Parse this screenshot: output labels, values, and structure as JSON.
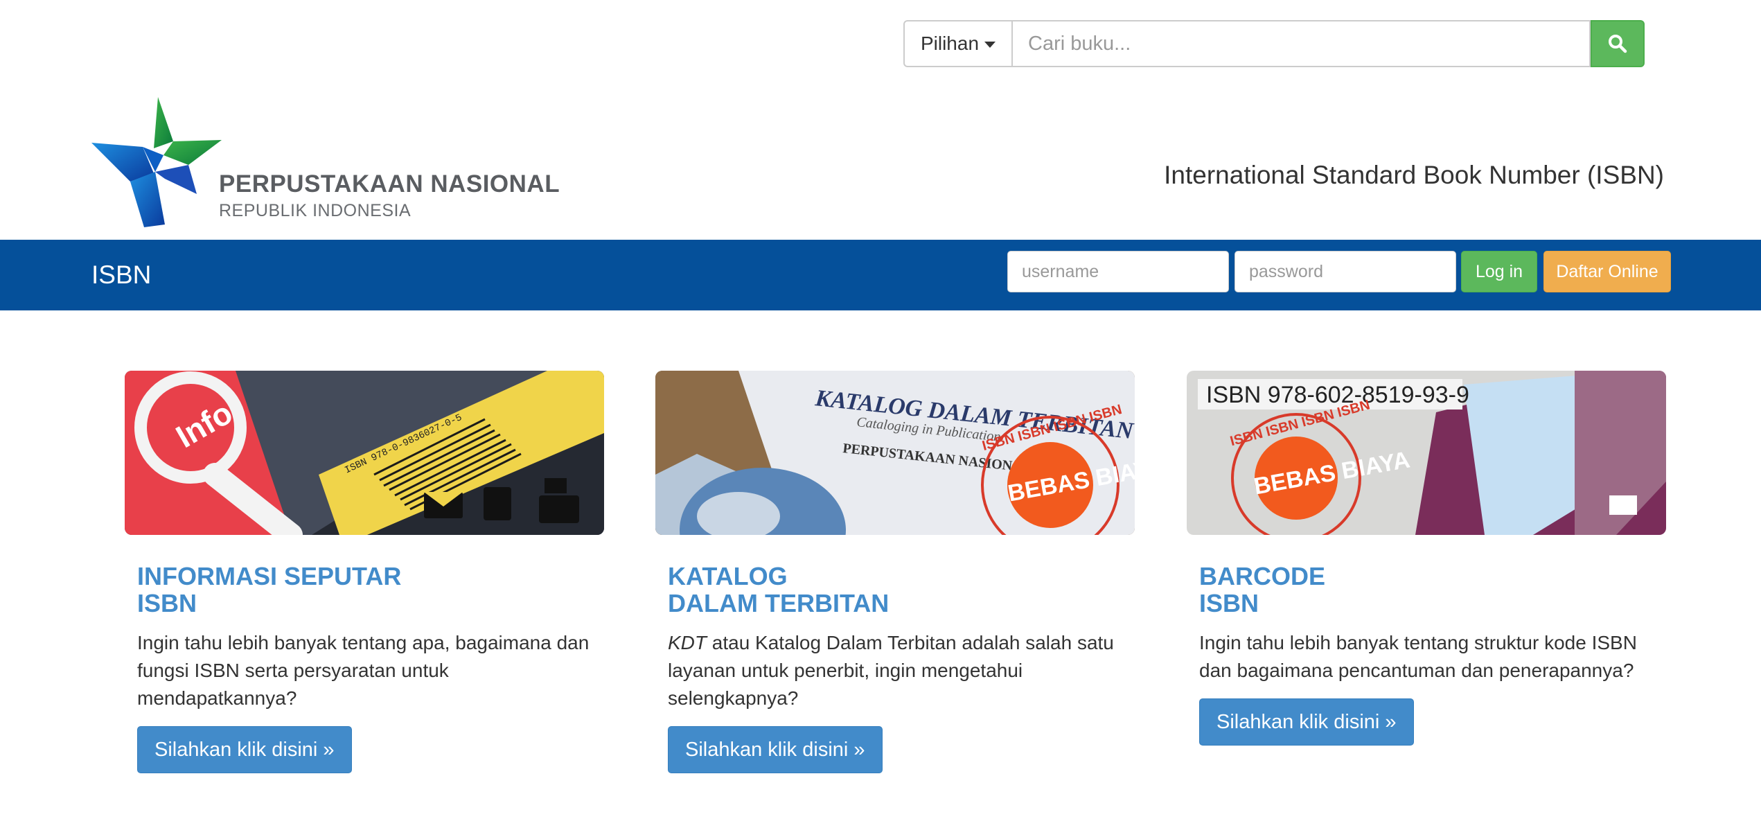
{
  "search": {
    "dropdown_label": "Pilihan",
    "placeholder": "Cari buku..."
  },
  "header": {
    "logo_title": "PERPUSTAKAAN NASIONAL",
    "logo_subtitle": "REPUBLIK INDONESIA",
    "tagline": "International Standard Book Number (ISBN)"
  },
  "navbar": {
    "brand": "ISBN",
    "username_placeholder": "username",
    "password_placeholder": "password",
    "login_label": "Log in",
    "register_label": "Daftar Online"
  },
  "cards": [
    {
      "title_line1": "INFORMASI SEPUTAR",
      "title_line2": "ISBN",
      "text": "Ingin tahu lebih banyak tentang apa, bagaimana dan fungsi ISBN serta persyaratan untuk mendapatkannya?",
      "button": "Silahkan klik disini »",
      "image_label": "Info",
      "barcode_text": "ISBN 978-0-9836027-0-5"
    },
    {
      "title_line1": "KATALOG",
      "title_line2": "DALAM TERBITAN",
      "text_em": "KDT",
      "text": " atau Katalog Dalam Terbitan adalah salah satu layanan untuk penerbit, ingin mengetahui selengkapnya?",
      "button": "Silahkan klik disini »",
      "image_heading": "KATALOG DALAM TERBITAN (KDT)",
      "image_subheading": "Cataloging in Publication",
      "image_publisher": "PERPUSTAKAAN NASIONAL",
      "stamp": "BEBAS BIAYA",
      "stamp_ring": "ISBN ISBN ISBN ISBN"
    },
    {
      "title_line1": "BARCODE",
      "title_line2": "ISBN",
      "text": "Ingin tahu lebih banyak tentang struktur kode ISBN dan bagaimana pencantuman dan penerapannya?",
      "button": "Silahkan klik disini »",
      "image_isbn": "ISBN 978-602-8519-93-9",
      "stamp": "BEBAS BIAYA",
      "stamp_ring": "ISBN ISBN ISBN ISBN"
    }
  ],
  "colors": {
    "navbar": "#05509a",
    "success": "#5cb85c",
    "warning": "#f0ad4e",
    "primary": "#428bca"
  }
}
